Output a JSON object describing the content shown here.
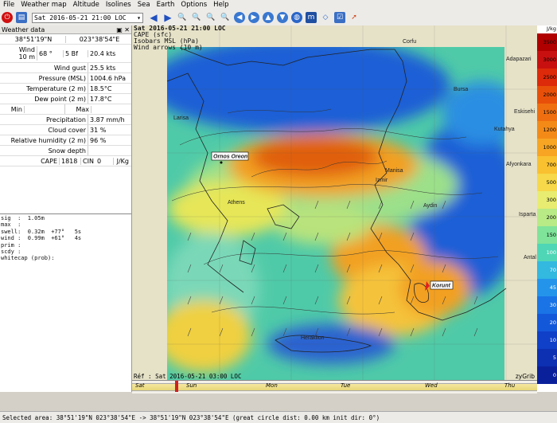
{
  "menu": [
    "File",
    "Weather map",
    "Altitude",
    "Isolines",
    "Sea",
    "Earth",
    "Options",
    "Help"
  ],
  "toolbar": {
    "date": "Sat 2016-05-21 21:00 LOC"
  },
  "panel": {
    "title": "Weather data",
    "coord_lat": "38°51'19\"N",
    "coord_lon": "023°38'54\"E",
    "wind_label": "Wind\n10 m",
    "wind_dir": "68 °",
    "wind_bf": "5 Bf",
    "wind_speed": "20.4 kts",
    "rows": [
      {
        "label": "Wind gust",
        "value": "25.5 kts"
      },
      {
        "label": "Pressure (MSL)",
        "value": "1004.6 hPa"
      },
      {
        "label": "Temperature (2 m)",
        "value": "18.5°C"
      },
      {
        "label": "Dew point (2 m)",
        "value": "17.8°C"
      }
    ],
    "min_label": "Min",
    "max_label": "Max",
    "rows2": [
      {
        "label": "Precipitation",
        "value": "3.87 mm/h"
      },
      {
        "label": "Cloud cover",
        "value": "31 %"
      },
      {
        "label": "Relative humidity (2 m)",
        "value": "96 %"
      },
      {
        "label": "Snow depth",
        "value": ""
      }
    ],
    "cape_label": "CAPE",
    "cape_value": "1818",
    "cin_label": "CIN",
    "cin_value": "0",
    "cape_unit": "J/Kg",
    "wave_text": "sig  :  1.05m\nmax  :\nswell:  0.32m  +77°   5s\nwind :  0.99m  +61°   4s\nprim :\nscdy :\nwhitecap (prob):"
  },
  "map": {
    "title_lines": [
      "Sat 2016-05-21 21:00 LOC",
      "CAPE (sfc)",
      "Isobars MSL (hPa)",
      "Wind arrows (10 m)"
    ],
    "ref_text": "Réf : Sat 2016-05-21 03:00 LOC",
    "brand": "zyGrib",
    "places": [
      {
        "name": "Ornos Oreon",
        "boxed": true
      },
      {
        "name": "Korunt",
        "boxed": false
      },
      {
        "name": "Corfu",
        "boxed": false
      },
      {
        "name": "Larisa",
        "boxed": false
      },
      {
        "name": "Athens",
        "boxed": false
      },
      {
        "name": "Manisa",
        "boxed": false
      },
      {
        "name": "Izmir",
        "boxed": false
      },
      {
        "name": "Aydin",
        "boxed": false
      },
      {
        "name": "Bursa",
        "boxed": false
      },
      {
        "name": "Adapazari",
        "boxed": false
      },
      {
        "name": "Eskisehi",
        "boxed": false
      },
      {
        "name": "Kutahya",
        "boxed": false
      },
      {
        "name": "Afyonkara",
        "boxed": false
      },
      {
        "name": "Isparta",
        "boxed": false
      },
      {
        "name": "Antal",
        "boxed": false
      },
      {
        "name": "Heraklion",
        "boxed": false
      }
    ],
    "timeline_days": [
      "Sat",
      "Sun",
      "Mon",
      "Tue",
      "Wed",
      "Thu"
    ]
  },
  "colorbar": {
    "unit": "J/kg",
    "labels": [
      "3500",
      "3000",
      "2500",
      "2000",
      "1500",
      "1200",
      "1000",
      "700",
      "500",
      "300",
      "200",
      "150",
      "100",
      "70",
      "45",
      "30",
      "20",
      "10",
      "5",
      "0"
    ],
    "colors": [
      "#b00000",
      "#c81010",
      "#dd2a0a",
      "#e8500a",
      "#ef6f10",
      "#f38a18",
      "#f7a523",
      "#f9c030",
      "#f6d84a",
      "#e8ec70",
      "#b8ea86",
      "#7fe39a",
      "#4fd6b6",
      "#33b8e0",
      "#2494ea",
      "#1a74e6",
      "#1458da",
      "#1040c8",
      "#0d2fb2",
      "#0a209a"
    ]
  },
  "status": {
    "text": "Selected area:  38°51'19\"N  023°38'54\"E -> 38°51'19\"N  023°38'54\"E   (great circle dist: 0.00 km  init dir: 0°)"
  }
}
